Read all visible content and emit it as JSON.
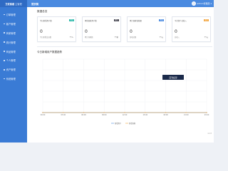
{
  "app": {
    "logo_main": "方武商城",
    "logo_sub": "主管理"
  },
  "sidebar": {
    "items": [
      {
        "label": "订单管理"
      },
      {
        "label": "客户管理"
      },
      {
        "label": "商家管理"
      },
      {
        "label": "统计管理"
      },
      {
        "label": "商品管理"
      },
      {
        "label": "个人管理"
      },
      {
        "label": "资产管理"
      },
      {
        "label": "系统管理"
      }
    ]
  },
  "topbar": {
    "tab_label": "首页简",
    "username": "admin管理员",
    "caret": "▾"
  },
  "main": {
    "section_title": "数据总览",
    "cards": [
      {
        "label": "今日新增用户数",
        "badge": "今日",
        "badge_color": "#26b7a7",
        "value": "0",
        "sub_label": "今日新增会员数",
        "unit": "个/人"
      },
      {
        "label": "累积商家用户数",
        "badge": "累计",
        "badge_color": "#3f3f4b",
        "value": "0",
        "sub_label": "累计商家数",
        "unit": "个/家"
      },
      {
        "label": "累计商家营收量",
        "badge": "今日",
        "badge_color": "#4a8ae0",
        "value": "0",
        "sub_label": "营收总数",
        "unit": "个/元"
      },
      {
        "label": "平台资产总收入",
        "badge": "近日",
        "badge_color": "#f2a33a",
        "value": "0",
        "sub_label": "总收入",
        "unit": "个/元"
      }
    ],
    "chart_title": "今日新增用户数据趋势"
  },
  "chart_data": {
    "type": "line",
    "x": [
      "00:00",
      "03:00",
      "06:00",
      "09:00",
      "12:00",
      "15:00",
      "18:00",
      "21:00",
      "23:00"
    ],
    "series": [
      {
        "name": "新增用户",
        "color": "#4a8ae0",
        "values": [
          0,
          0,
          0,
          0,
          0,
          0,
          0,
          0,
          0
        ]
      },
      {
        "name": "新增商家",
        "color": "#f2a33a",
        "values": [
          0,
          0,
          0,
          0,
          0,
          0,
          0,
          0,
          0
        ]
      }
    ],
    "ylim": [
      0,
      1
    ],
    "grid": true,
    "legend": "bottom-center"
  },
  "float_button": "回到底部"
}
